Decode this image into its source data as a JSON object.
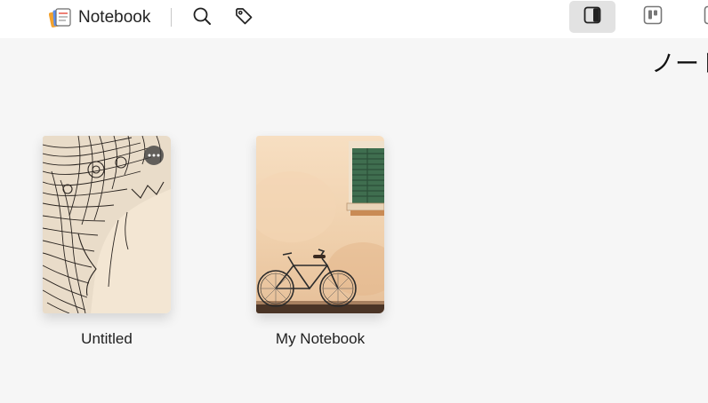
{
  "header": {
    "app_name": "Notebook",
    "logo_icon": "notebook-stack-icon",
    "search_icon": "search-icon",
    "tags_icon": "tag-icon",
    "view_buttons": [
      {
        "icon": "split-view-icon",
        "active": true
      },
      {
        "icon": "board-view-icon",
        "active": false
      },
      {
        "icon": "list-view-icon",
        "active": false
      }
    ]
  },
  "main": {
    "heading": "ノート",
    "notebooks": [
      {
        "title": "Untitled",
        "cover": "ornamental-elephant-sketch",
        "has_more_menu": true
      },
      {
        "title": "My Notebook",
        "cover": "bicycle-by-green-window",
        "has_more_menu": false
      }
    ]
  },
  "colors": {
    "topbar_bg": "#ffffff",
    "page_bg": "#f6f6f6",
    "active_view_bg": "#e2e2e2"
  }
}
